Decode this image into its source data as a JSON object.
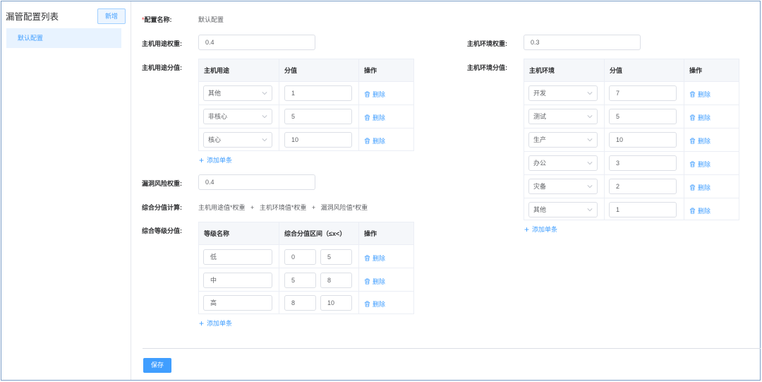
{
  "sidebar": {
    "title": "漏管配置列表",
    "add_label": "新增",
    "items": [
      {
        "label": "默认配置"
      }
    ]
  },
  "form": {
    "name_label": "配置名称:",
    "name_required_mark": "*",
    "name_value": "默认配置",
    "host_use_weight_label": "主机用途权重:",
    "host_use_weight_value": "0.4",
    "host_env_weight_label": "主机环境权重:",
    "host_env_weight_value": "0.3",
    "host_use_score_label": "主机用途分值:",
    "host_env_score_label": "主机环境分值:",
    "vuln_risk_weight_label": "漏洞风险权重:",
    "vuln_risk_weight_value": "0.4",
    "composite_calc_label": "综合分值计算:",
    "composite_calc_parts": [
      "主机用途值*权重",
      "+",
      "主机环境值*权重",
      "+",
      "漏洞风险值*权重"
    ],
    "composite_level_label": "综合等级分值:",
    "add_row_label": "添加单条",
    "delete_label": "删除",
    "save_label": "保存"
  },
  "host_use_table": {
    "headers": [
      "主机用途",
      "分值",
      "操作"
    ],
    "rows": [
      {
        "use": "其他",
        "score": "1"
      },
      {
        "use": "非核心",
        "score": "5"
      },
      {
        "use": "核心",
        "score": "10"
      }
    ]
  },
  "host_env_table": {
    "headers": [
      "主机环境",
      "分值",
      "操作"
    ],
    "rows": [
      {
        "env": "开发",
        "score": "7"
      },
      {
        "env": "测试",
        "score": "5"
      },
      {
        "env": "生产",
        "score": "10"
      },
      {
        "env": "办公",
        "score": "3"
      },
      {
        "env": "灾备",
        "score": "2"
      },
      {
        "env": "其他",
        "score": "1"
      }
    ]
  },
  "level_table": {
    "headers": [
      "等级名称",
      "综合分值区间（≤x<）",
      "操作"
    ],
    "rows": [
      {
        "name": "低",
        "min": "0",
        "max": "5"
      },
      {
        "name": "中",
        "min": "5",
        "max": "8"
      },
      {
        "name": "高",
        "min": "8",
        "max": "10"
      }
    ]
  },
  "colors": {
    "accent": "#409eff",
    "border": "#dcdfe6",
    "header_bg": "#f5f7fa"
  },
  "icons": {
    "chevron": "chevron-down-icon",
    "trash": "trash-icon",
    "plus": "plus-icon"
  }
}
